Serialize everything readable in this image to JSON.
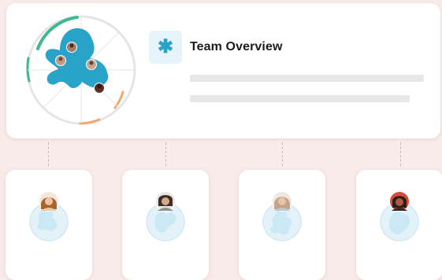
{
  "team": {
    "icon": "asterisk-icon",
    "icon_glyph": "✱",
    "title": "Team Overview"
  },
  "colors": {
    "background": "#f9ebe9",
    "card": "#ffffff",
    "accent_blue": "#2aa3c8",
    "blob_light": "#cbe8f5",
    "ring_green": "#3dba8c",
    "ring_orange": "#f3a76c",
    "skeleton": "#e7e7e7"
  },
  "members": [
    {
      "avatar": "avatar-icon",
      "hair": "#a5652c",
      "skin": "#f1c3a5",
      "shirt": "#e6caa8"
    },
    {
      "avatar": "avatar-icon",
      "hair": "#3a2e2a",
      "skin": "#d6a98b",
      "shirt": "#8f9288"
    },
    {
      "avatar": "avatar-icon",
      "hair": "#c3a488",
      "skin": "#e9c3a8",
      "shirt": "#c1c5c9"
    },
    {
      "avatar": "avatar-icon",
      "hair": "#2a1e1c",
      "skin": "#b0573c",
      "shirt": "#2b2b30"
    }
  ]
}
